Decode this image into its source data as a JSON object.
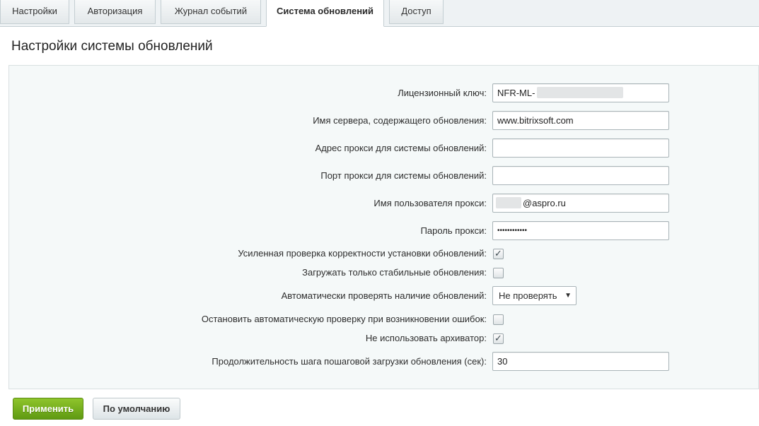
{
  "tabs": [
    {
      "label": "Настройки"
    },
    {
      "label": "Авторизация"
    },
    {
      "label": "Журнал событий"
    },
    {
      "label": "Система обновлений",
      "active": true
    },
    {
      "label": "Доступ"
    }
  ],
  "page": {
    "title": "Настройки системы обновлений"
  },
  "form": {
    "license_key": {
      "label": "Лицензионный ключ:",
      "value": "NFR-ML-"
    },
    "server_name": {
      "label": "Имя сервера, содержащего обновления:",
      "value": "www.bitrixsoft.com"
    },
    "proxy_address": {
      "label": "Адрес прокси для системы обновлений:",
      "value": ""
    },
    "proxy_port": {
      "label": "Порт прокси для системы обновлений:",
      "value": ""
    },
    "proxy_user": {
      "label": "Имя пользователя прокси:",
      "value": "@aspro.ru"
    },
    "proxy_password": {
      "label": "Пароль прокси:",
      "value": "••••••••••••"
    },
    "strict_check": {
      "label": "Усиленная проверка корректности установки обновлений:",
      "checked": true
    },
    "stable_only": {
      "label": "Загружать только стабильные обновления:",
      "checked": false
    },
    "auto_check": {
      "label": "Автоматически проверять наличие обновлений:",
      "value": "Не проверять"
    },
    "stop_on_error": {
      "label": "Остановить автоматическую проверку при возникновении ошибок:",
      "checked": false
    },
    "no_archiver": {
      "label": "Не использовать архиватор:",
      "checked": true
    },
    "step_duration": {
      "label": "Продолжительность шага пошаговой загрузки обновления (сек):",
      "value": "30"
    }
  },
  "buttons": {
    "apply": "Применить",
    "default": "По умолчанию"
  },
  "icons": {
    "checkmark": "check-icon",
    "dropdown": "triangle-down-icon"
  },
  "colors": {
    "apply_button": "#6aa61a",
    "panel_bg": "#f5f9f9"
  }
}
